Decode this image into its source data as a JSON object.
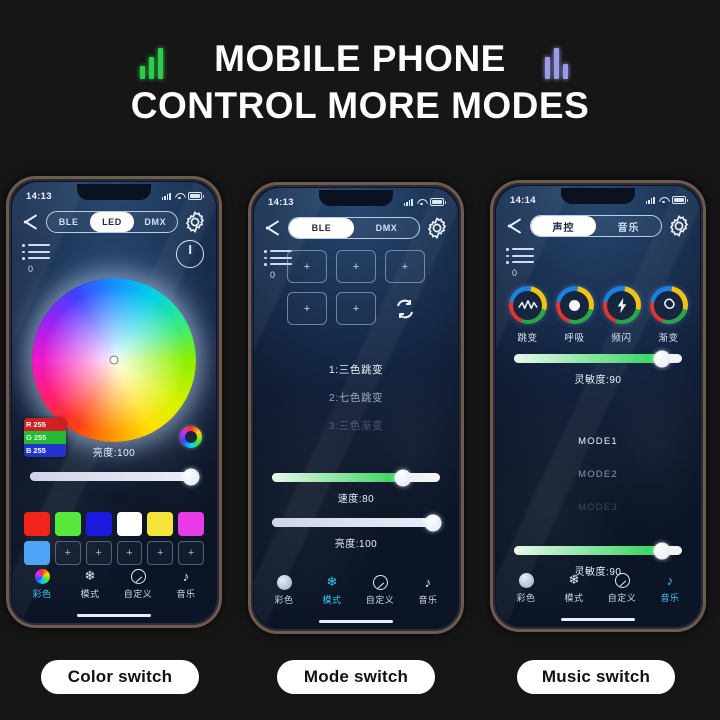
{
  "header": {
    "title_line1": "MOBILE PHONE",
    "title_line2": "CONTROL MORE MODES",
    "eq_left_color": "#2fcc4a",
    "eq_right_color": "#9d9ae8"
  },
  "phones": [
    {
      "id": "color-switch",
      "status": {
        "clock": "14:13"
      },
      "tabs": [
        {
          "label": "BLE",
          "active": false
        },
        {
          "label": "LED",
          "active": true
        },
        {
          "label": "DMX",
          "active": false
        }
      ],
      "rail_value": "0",
      "rgb": {
        "r_key": "R",
        "r_value": "255",
        "g_key": "G",
        "g_value": "255",
        "b_key": "B",
        "b_value": "255"
      },
      "brightness_label": "亮度:100",
      "brightness_percent": 96,
      "swatches_row1": [
        "#f02418",
        "#56e83c",
        "#1b1be0",
        "#ffffff",
        "#f7e438",
        "#e83ce8"
      ],
      "swatches_row2": [
        "#4ea4f7",
        "+",
        "+",
        "+",
        "+",
        "+"
      ],
      "nav": [
        {
          "label": "彩色",
          "icon": "color-wheel-icon",
          "active": true
        },
        {
          "label": "模式",
          "icon": "snowflake-icon",
          "active": false
        },
        {
          "label": "自定义",
          "icon": "compass-icon",
          "active": false
        },
        {
          "label": "音乐",
          "icon": "music-note-icon",
          "active": false
        }
      ]
    },
    {
      "id": "mode-switch",
      "status": {
        "clock": "14:13"
      },
      "tabs": [
        {
          "label": "BLE",
          "active": true
        },
        {
          "label": "DMX",
          "active": false
        }
      ],
      "rail_value": "0",
      "pads": [
        "+",
        "+",
        "+",
        "+",
        "+"
      ],
      "refresh_icon": "refresh-icon",
      "modes": [
        "1:三色跳变",
        "2:七色跳变",
        "3:三色渐变"
      ],
      "speed_label": "速度:80",
      "speed_percent": 78,
      "brightness_label": "亮度:100",
      "brightness_percent": 96,
      "nav": [
        {
          "label": "彩色",
          "icon": "color-wheel-icon",
          "active": false
        },
        {
          "label": "模式",
          "icon": "snowflake-icon",
          "active": true
        },
        {
          "label": "自定义",
          "icon": "compass-icon",
          "active": false
        },
        {
          "label": "音乐",
          "icon": "music-note-icon",
          "active": false
        }
      ]
    },
    {
      "id": "music-switch",
      "status": {
        "clock": "14:14"
      },
      "tabs": [
        {
          "label": "声控",
          "active": true
        },
        {
          "label": "音乐",
          "active": false
        }
      ],
      "rail_value": "0",
      "circles": [
        {
          "label": "跳变",
          "icon": "waveform-icon"
        },
        {
          "label": "呼吸",
          "icon": "breathe-dot-icon"
        },
        {
          "label": "频闪",
          "icon": "lightning-icon"
        },
        {
          "label": "渐变",
          "icon": "swirl-icon"
        }
      ],
      "sensitivity_top_label": "灵敏度:90",
      "sensitivity_top_percent": 88,
      "modes": [
        "MODE1",
        "MODE2",
        "MODE3"
      ],
      "sensitivity_bottom_label": "灵敏度:90",
      "sensitivity_bottom_percent": 88,
      "nav": [
        {
          "label": "彩色",
          "icon": "color-wheel-icon",
          "active": false
        },
        {
          "label": "模式",
          "icon": "snowflake-icon",
          "active": false
        },
        {
          "label": "自定义",
          "icon": "compass-icon",
          "active": false
        },
        {
          "label": "音乐",
          "icon": "music-note-icon",
          "active": true
        }
      ]
    }
  ],
  "captions": [
    {
      "label": "Color switch"
    },
    {
      "label": "Mode switch"
    },
    {
      "label": "Music switch"
    }
  ]
}
